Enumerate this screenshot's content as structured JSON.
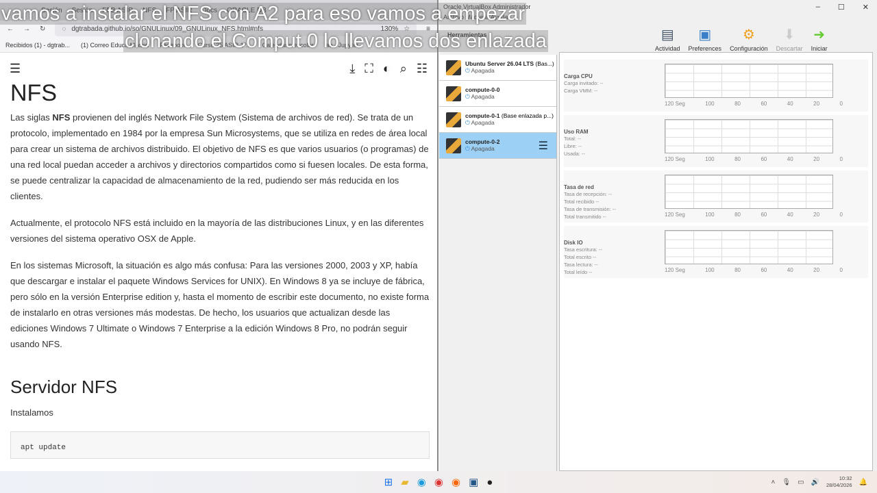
{
  "browser": {
    "tabs": [
      "Sesión",
      "Sesión",
      "FPB ASIR",
      "NFS",
      "FP ASIR",
      "Docs",
      "ORACLE DB"
    ],
    "url": "dgtrabada.github.io/so/GNULinux/09_GNULinux_NFS.html#nfs",
    "zoom": "130%",
    "bookmarks": [
      "Recibidos (1) - dgtrab...",
      "(1) Correo Educa Madrid",
      "Facebook",
      "Curso 25 ASIR 1º...",
      "Calendario escolar",
      "lab - Jupyter"
    ]
  },
  "doc": {
    "title": "NFS",
    "p1_pre": "Las siglas ",
    "p1_bold": "NFS",
    "p1_post": " provienen del inglés Network File System (Sistema de archivos de red). Se trata de un protocolo, implementado en 1984 por la empresa Sun Microsystems, que se utiliza en redes de área local para crear un sistema de archivos distribuido. El objetivo de NFS es que varios usuarios (o programas) de una red local puedan acceder a archivos y directorios compartidos como si fuesen locales. De esta forma, se puede centralizar la capacidad de almacenamiento de la red, pudiendo ser más reducida en los clientes.",
    "p2": "Actualmente, el protocolo NFS está incluido en la mayoría de las distribuciones Linux, y en las diferentes versiones del sistema operativo OSX de Apple.",
    "p3": "En los sistemas Microsoft, la situación es algo más confusa: Para las versiones 2000, 2003 y XP, había que descargar e instalar el paquete Windows Services for UNIX). En Windows 8 ya se incluye de fábrica, pero sólo en la versión Enterprise edition y, hasta el momento de escribir este documento, no existe forma de instalarlo en otras versiones más modestas. De hecho, los usuarios que actualizan desde las ediciones Windows 7 Ultimate o Windows 7 Enterprise a la edición Windows 8 Pro, no podrán seguir usando NFS.",
    "h2": "Servidor NFS",
    "p4": "Instalamos",
    "code": "apt update"
  },
  "vbox": {
    "title": "Oracle VirtualBox Administrador",
    "menu": "Archivo  Máquina  Ayuda",
    "tools_label": "Herramientas",
    "toolbar": [
      "Actividad",
      "Preferences",
      "Configuración",
      "Descartar",
      "Iniciar"
    ],
    "vms": [
      {
        "name": "Ubuntu Server 26.04 LTS",
        "note": "(Bas...)",
        "state": "Apagada"
      },
      {
        "name": "compute-0-0",
        "note": "",
        "state": "Apagada"
      },
      {
        "name": "compute-0-1",
        "note": "(Base enlazada p...)",
        "state": "Apagada"
      },
      {
        "name": "compute-0-2",
        "note": "",
        "state": "Apagada"
      }
    ],
    "panels": [
      {
        "title": "Carga CPU",
        "lines": [
          "Carga invitado: --",
          "Carga VMM: --"
        ]
      },
      {
        "title": "Uso RAM",
        "lines": [
          "Total: --",
          "Libre: --",
          "Usada: --"
        ]
      },
      {
        "title": "Tasa de red",
        "lines": [
          "Tasa de recepción: --",
          "Total recibido --",
          "Tasa de transmisión: --",
          "Total transmitido --"
        ]
      },
      {
        "title": "Disk IO",
        "lines": [
          "Tasa escritura: --",
          "Total escrito --",
          "Tasa lectura: --",
          "Total leído --"
        ]
      }
    ],
    "ticks": [
      "120 Seg",
      "100",
      "80",
      "60",
      "40",
      "20",
      "0"
    ]
  },
  "subtitles": [
    "vamos a instalar el NFS con A2 para eso vamos a empezar",
    "clonando el Comput 0 lo llevamos dos enlazada"
  ],
  "tray": {
    "time": "10:32",
    "date": "28/04/2026"
  }
}
